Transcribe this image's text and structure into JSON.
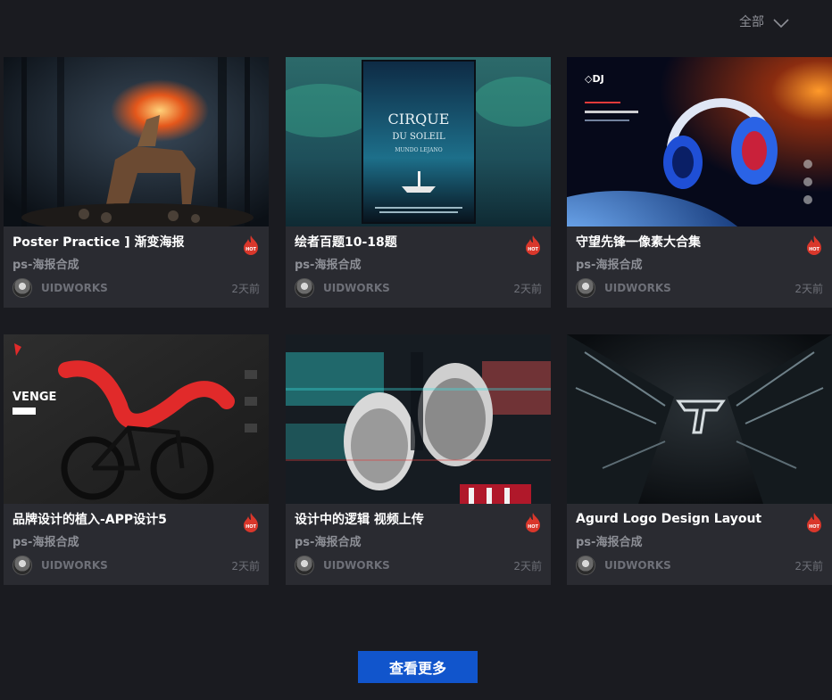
{
  "filter": {
    "label": "全部"
  },
  "cards": [
    {
      "title": "Poster Practice ] 渐变海报",
      "category": "ps-海报合成",
      "author": "UIDWORKS",
      "time": "2天前"
    },
    {
      "title": "绘者百题10-18题",
      "category": "ps-海报合成",
      "author": "UIDWORKS",
      "time": "2天前"
    },
    {
      "title": "守望先锋一像素大合集",
      "category": "ps-海报合成",
      "author": "UIDWORKS",
      "time": "2天前"
    },
    {
      "title": "品牌设计的植入-APP设计5",
      "category": "ps-海报合成",
      "author": "UIDWORKS",
      "time": "2天前"
    },
    {
      "title": "设计中的逻辑 视频上传",
      "category": "ps-海报合成",
      "author": "UIDWORKS",
      "time": "2天前"
    },
    {
      "title": "Agurd Logo Design Layout",
      "category": "ps-海报合成",
      "author": "UIDWORKS",
      "time": "2天前"
    }
  ],
  "more_button": {
    "label": "查看更多"
  },
  "colors": {
    "background": "#1a1b20",
    "card": "#2a2b31",
    "accent": "#1155cc",
    "hot": "#d9372b"
  }
}
